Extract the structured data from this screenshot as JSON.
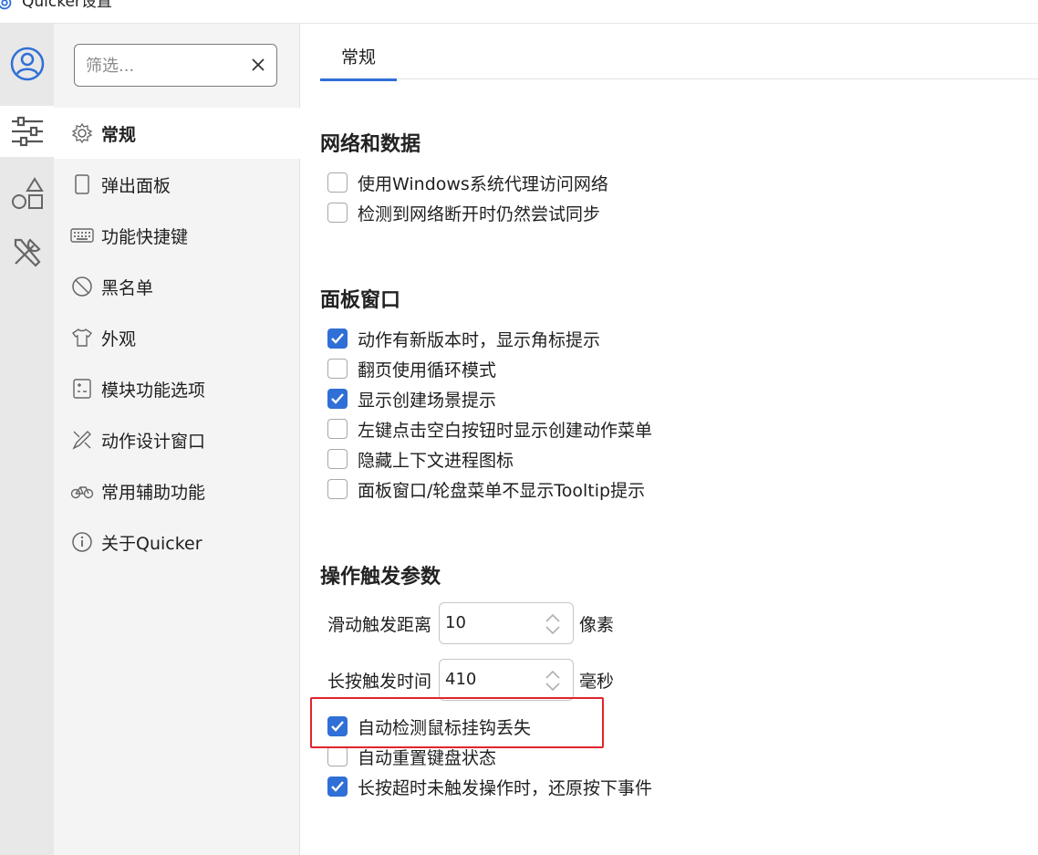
{
  "window": {
    "title": "Quicker设置"
  },
  "rail": [
    {
      "name": "user-icon",
      "active": true
    },
    {
      "name": "sliders-icon",
      "active": false
    },
    {
      "name": "shapes-icon",
      "active": false
    },
    {
      "name": "tools-icon",
      "active": false
    }
  ],
  "filter": {
    "placeholder": "筛选..."
  },
  "nav": {
    "items": [
      {
        "label": "常规",
        "icon": "gear-icon"
      },
      {
        "label": "弹出面板",
        "icon": "panel-icon"
      },
      {
        "label": "功能快捷键",
        "icon": "keyboard-icon"
      },
      {
        "label": "黑名单",
        "icon": "block-icon"
      },
      {
        "label": "外观",
        "icon": "shirt-icon"
      },
      {
        "label": "模块功能选项",
        "icon": "module-icon"
      },
      {
        "label": "动作设计窗口",
        "icon": "design-icon"
      },
      {
        "label": "常用辅助功能",
        "icon": "bike-icon"
      },
      {
        "label": "关于Quicker",
        "icon": "info-icon"
      }
    ]
  },
  "tabs": [
    {
      "label": "常规"
    }
  ],
  "sections": {
    "network": {
      "title": "网络和数据",
      "options": [
        {
          "label": "使用Windows系统代理访问网络",
          "checked": false
        },
        {
          "label": "检测到网络断开时仍然尝试同步",
          "checked": false
        }
      ]
    },
    "panel": {
      "title": "面板窗口",
      "options": [
        {
          "label": "动作有新版本时，显示角标提示",
          "checked": true
        },
        {
          "label": "翻页使用循环模式",
          "checked": false
        },
        {
          "label": "显示创建场景提示",
          "checked": true
        },
        {
          "label": "左键点击空白按钮时显示创建动作菜单",
          "checked": false
        },
        {
          "label": "隐藏上下文进程图标",
          "checked": false
        },
        {
          "label": "面板窗口/轮盘菜单不显示Tooltip提示",
          "checked": false
        }
      ]
    },
    "trigger": {
      "title": "操作触发参数",
      "params": [
        {
          "label": "滑动触发距离",
          "value": "10",
          "unit": "像素"
        },
        {
          "label": "长按触发时间",
          "value": "410",
          "unit": "毫秒"
        }
      ],
      "options": [
        {
          "label": "自动检测鼠标挂钩丢失",
          "checked": true
        },
        {
          "label": "自动重置键盘状态",
          "checked": false
        },
        {
          "label": "长按超时未触发操作时，还原按下事件",
          "checked": true
        }
      ]
    }
  },
  "colors": {
    "accent": "#2f6fd6",
    "highlight": "#e0252c"
  }
}
